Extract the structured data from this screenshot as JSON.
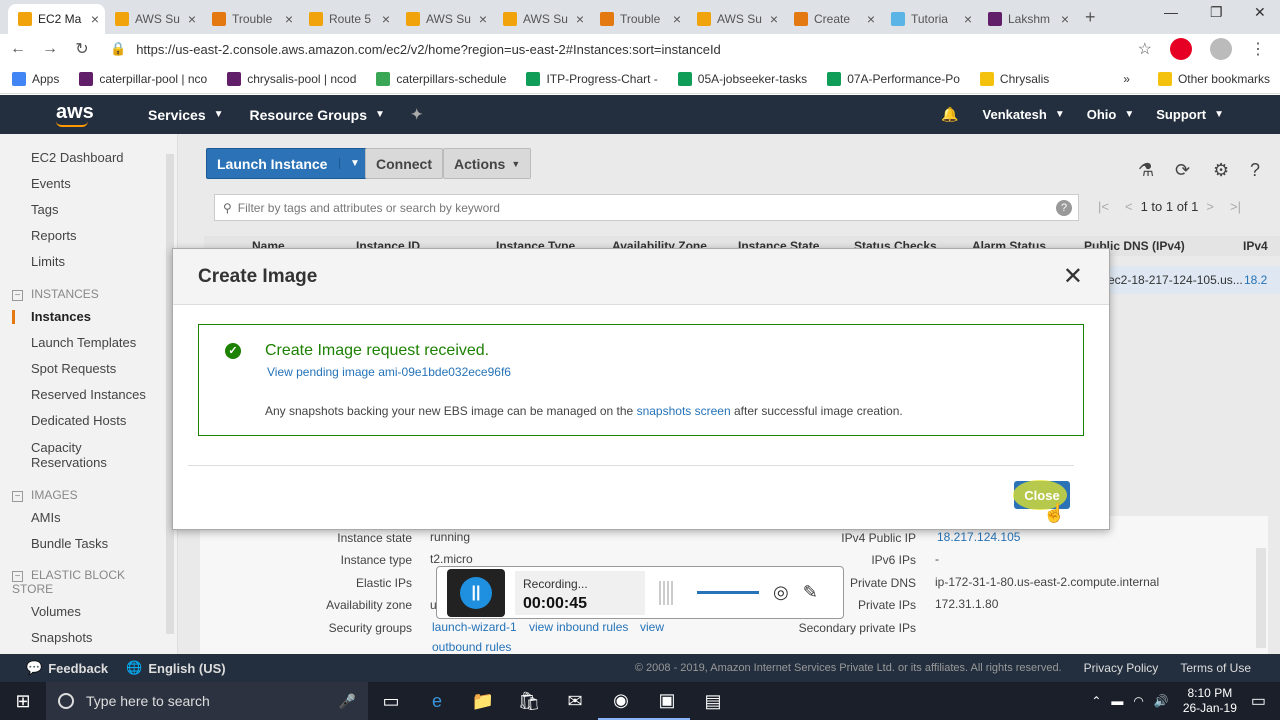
{
  "browser": {
    "tabs": [
      {
        "title": "EC2 Ma",
        "color": "#f0a30a",
        "active": true
      },
      {
        "title": "AWS Su",
        "color": "#f0a30a"
      },
      {
        "title": "Trouble",
        "color": "#e47911"
      },
      {
        "title": "Route 5",
        "color": "#f0a30a"
      },
      {
        "title": "AWS Su",
        "color": "#f0a30a"
      },
      {
        "title": "AWS Su",
        "color": "#f0a30a"
      },
      {
        "title": "Trouble",
        "color": "#e47911"
      },
      {
        "title": "AWS Su",
        "color": "#f0a30a"
      },
      {
        "title": "Create",
        "color": "#e47911"
      },
      {
        "title": "Tutoria",
        "color": "#5ab4e6"
      },
      {
        "title": "Lakshm",
        "color": "#611f69"
      }
    ],
    "url": "https://us-east-2.console.aws.amazon.com/ec2/v2/home?region=us-east-2#Instances:sort=instanceId",
    "bookmarks": [
      {
        "label": "Apps",
        "color": "#4285f4"
      },
      {
        "label": "caterpillar-pool | nco",
        "color": "#611f69"
      },
      {
        "label": "chrysalis-pool | ncod",
        "color": "#611f69"
      },
      {
        "label": "caterpillars-schedule",
        "color": "#3aa757"
      },
      {
        "label": "ITP-Progress-Chart -",
        "color": "#0f9d58"
      },
      {
        "label": "05A-jobseeker-tasks",
        "color": "#0f9d58"
      },
      {
        "label": "07A-Performance-Po",
        "color": "#0f9d58"
      },
      {
        "label": "Chrysalis",
        "color": "#f4c20d"
      }
    ],
    "more_bookmarks": "»",
    "other_bookmarks": "Other bookmarks"
  },
  "aws_header": {
    "logo": "aws",
    "services": "Services",
    "resource_groups": "Resource Groups",
    "user": "Venkatesh",
    "region": "Ohio",
    "support": "Support"
  },
  "sidebar": {
    "ec2_dashboard": "EC2 Dashboard",
    "events": "Events",
    "tags": "Tags",
    "reports": "Reports",
    "limits": "Limits",
    "sec_instances": "INSTANCES",
    "instances": "Instances",
    "launch_templates": "Launch Templates",
    "spot_requests": "Spot Requests",
    "reserved_instances": "Reserved Instances",
    "dedicated_hosts": "Dedicated Hosts",
    "capacity_1": "Capacity",
    "capacity_2": "Reservations",
    "sec_images": "IMAGES",
    "amis": "AMIs",
    "bundle_tasks": "Bundle Tasks",
    "sec_ebs_1": "ELASTIC BLOCK",
    "sec_ebs_2": "STORE",
    "volumes": "Volumes",
    "snapshots": "Snapshots"
  },
  "toolbar": {
    "launch_instance": "Launch Instance",
    "connect": "Connect",
    "actions": "Actions",
    "filter_placeholder": "Filter by tags and attributes or search by keyword",
    "pager_text": "1 to 1 of 1"
  },
  "table": {
    "columns": [
      "Name",
      "Instance ID",
      "Instance Type",
      "Availability Zone",
      "Instance State",
      "Status Checks",
      "Alarm Status",
      "Public DNS (IPv4)",
      "IPv4"
    ],
    "row_dns": "ec2-18-217-124-105.us...",
    "row_ip": "18.2"
  },
  "details": {
    "instance_state_label": "Instance state",
    "instance_state": "running",
    "instance_type_label": "Instance type",
    "instance_type": "t2.micro",
    "elastic_ips_label": "Elastic IPs",
    "availability_zone_label": "Availability zone",
    "availability_zone": "us-east-2c",
    "security_groups_label": "Security groups",
    "security_group_link": "launch-wizard-1",
    "view_inbound": "view inbound rules",
    "view_outbound_1": "view",
    "view_outbound_2": "outbound rules",
    "ipv4_public_ip_label": "IPv4 Public IP",
    "ipv4_public_ip": "18.217.124.105",
    "ipv6_ips_label": "IPv6 IPs",
    "ipv6_ips": "-",
    "private_dns_label": "Private DNS",
    "private_dns": "ip-172-31-1-80.us-east-2.compute.internal",
    "private_ips_label": "Private IPs",
    "private_ips": "172.31.1.80",
    "secondary_private_ips_label": "Secondary private IPs"
  },
  "modal": {
    "title": "Create Image",
    "success_title": "Create Image request received.",
    "view_pending": "View pending image ami-09e1bde032ece96f6",
    "note_before": "Any snapshots backing your new EBS image can be managed on the ",
    "note_link": "snapshots screen",
    "note_after": " after successful image creation.",
    "close": "Close"
  },
  "recorder": {
    "status": "Recording...",
    "time": "00:00:45"
  },
  "footer": {
    "feedback": "Feedback",
    "language": "English (US)",
    "copyright": "© 2008 - 2019, Amazon Internet Services Private Ltd. or its affiliates. All rights reserved.",
    "privacy": "Privacy Policy",
    "terms": "Terms of Use"
  },
  "taskbar": {
    "search_placeholder": "Type here to search",
    "time": "8:10 PM",
    "date": "26-Jan-19"
  }
}
